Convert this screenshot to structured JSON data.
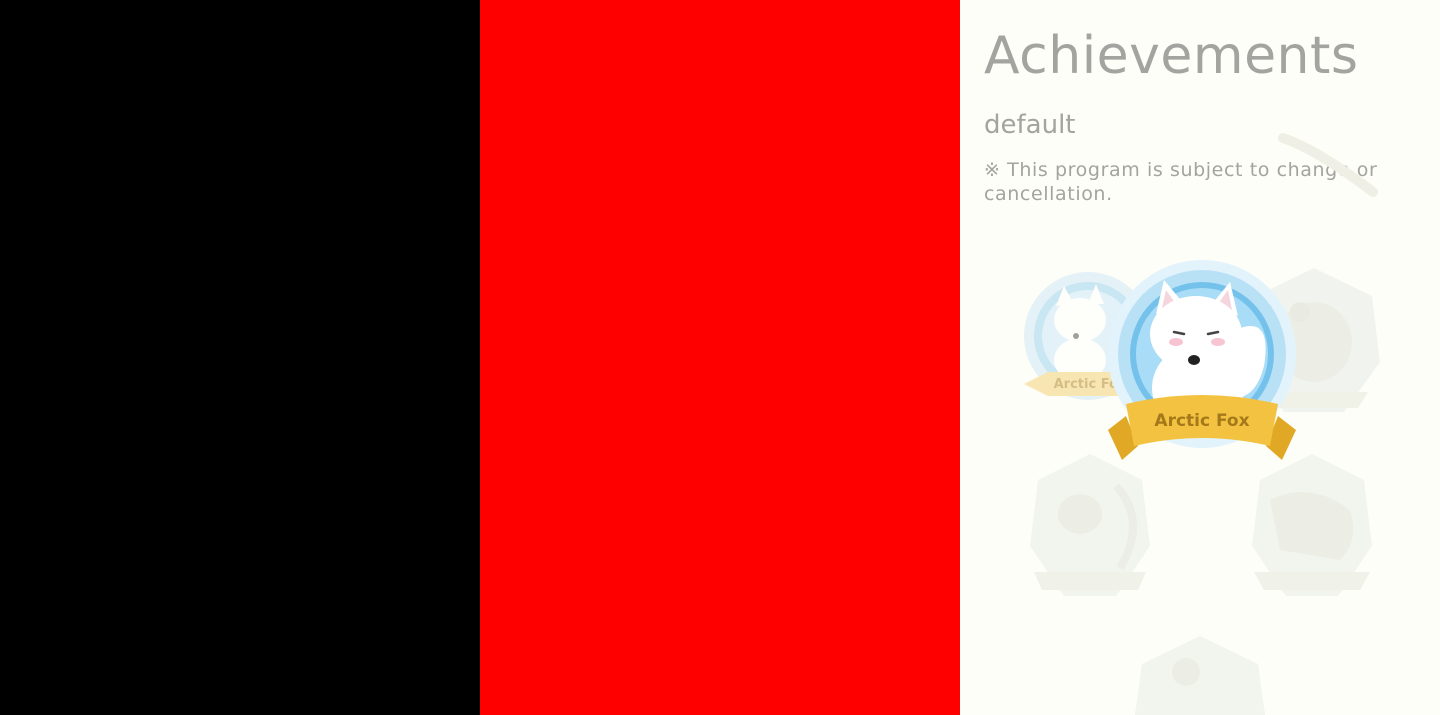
{
  "panels": {
    "left_color": "#000000",
    "middle_color": "#ff0000",
    "right_background": "#fefef8"
  },
  "header": {
    "title": "Achievements",
    "subtitle": "default",
    "notice": "※ This program is subject to change or cancellation."
  },
  "badges": {
    "featured": {
      "icon": "arctic-fox-badge-icon",
      "ribbon_label": "Arctic Fox"
    },
    "secondary_fox": {
      "icon": "arctic-fox-badge-small-icon",
      "ribbon_label": "Arctic Fox"
    },
    "locked": [
      {
        "icon": "locked-badge-top-right-icon"
      },
      {
        "icon": "locked-badge-mid-left-icon"
      },
      {
        "icon": "locked-badge-mid-right-icon"
      },
      {
        "icon": "locked-badge-bottom-icon"
      }
    ]
  },
  "colors": {
    "text_muted": "#a3a39f",
    "badge_ring": "#7fc7ee",
    "ribbon_gold": "#f2c240",
    "ribbon_text": "#a5791a"
  }
}
